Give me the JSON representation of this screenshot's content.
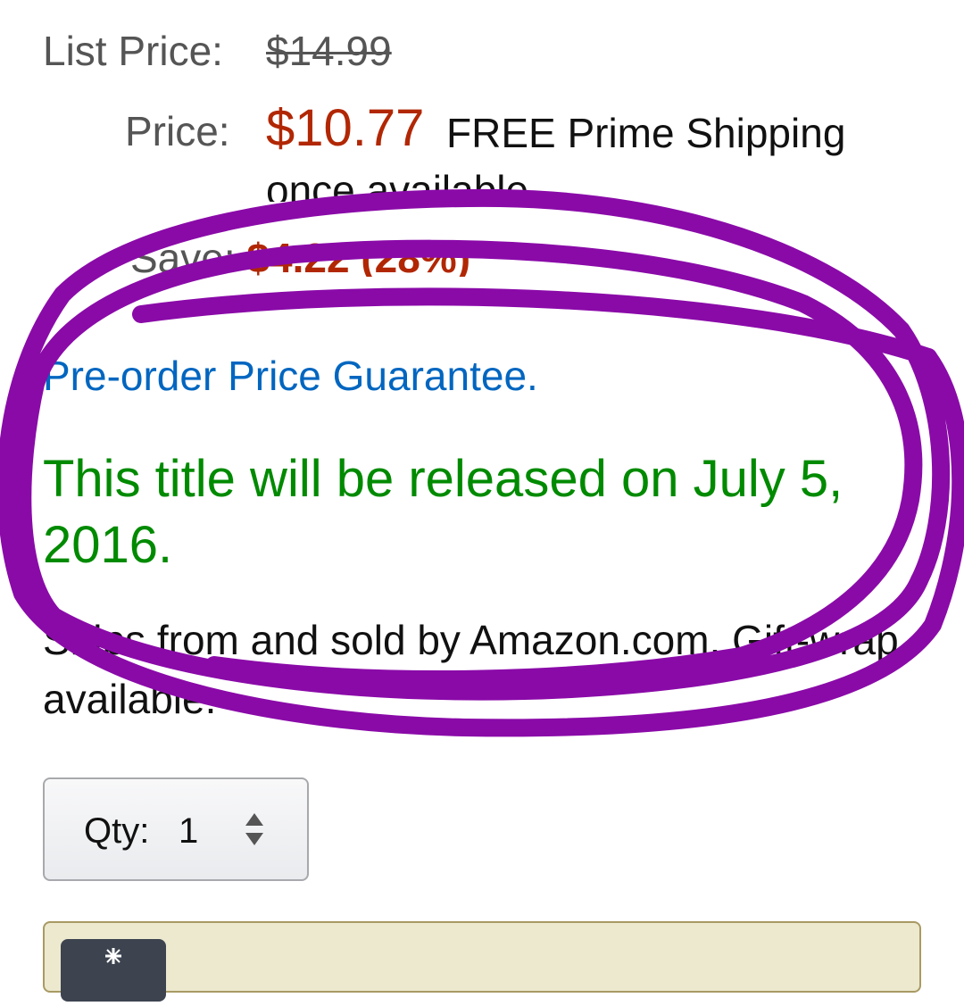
{
  "pricing": {
    "list_price_label": "List Price:",
    "list_price_value": "$14.99",
    "price_label": "Price:",
    "price_value": "$10.77",
    "shipping_text": "FREE Prime Shipping",
    "once_available": "once available",
    "save_label": "Save:",
    "save_value": "$4.22 (28%)"
  },
  "guarantee_link": "Pre-order Price Guarantee.",
  "release_text": "This title will be released on July 5, 2016.",
  "ships_text": "Ships from and sold by Amazon.com. Gift-wrap available.",
  "quantity": {
    "label": "Qty:",
    "value": "1"
  },
  "colors": {
    "price_red": "#b12704",
    "link_blue": "#0066c0",
    "release_green": "#008a00",
    "annotation_purple": "#8a0aa8"
  },
  "icons": {
    "qty_arrows": "up-down-arrows-icon",
    "cart_icon": "cart-icon"
  }
}
